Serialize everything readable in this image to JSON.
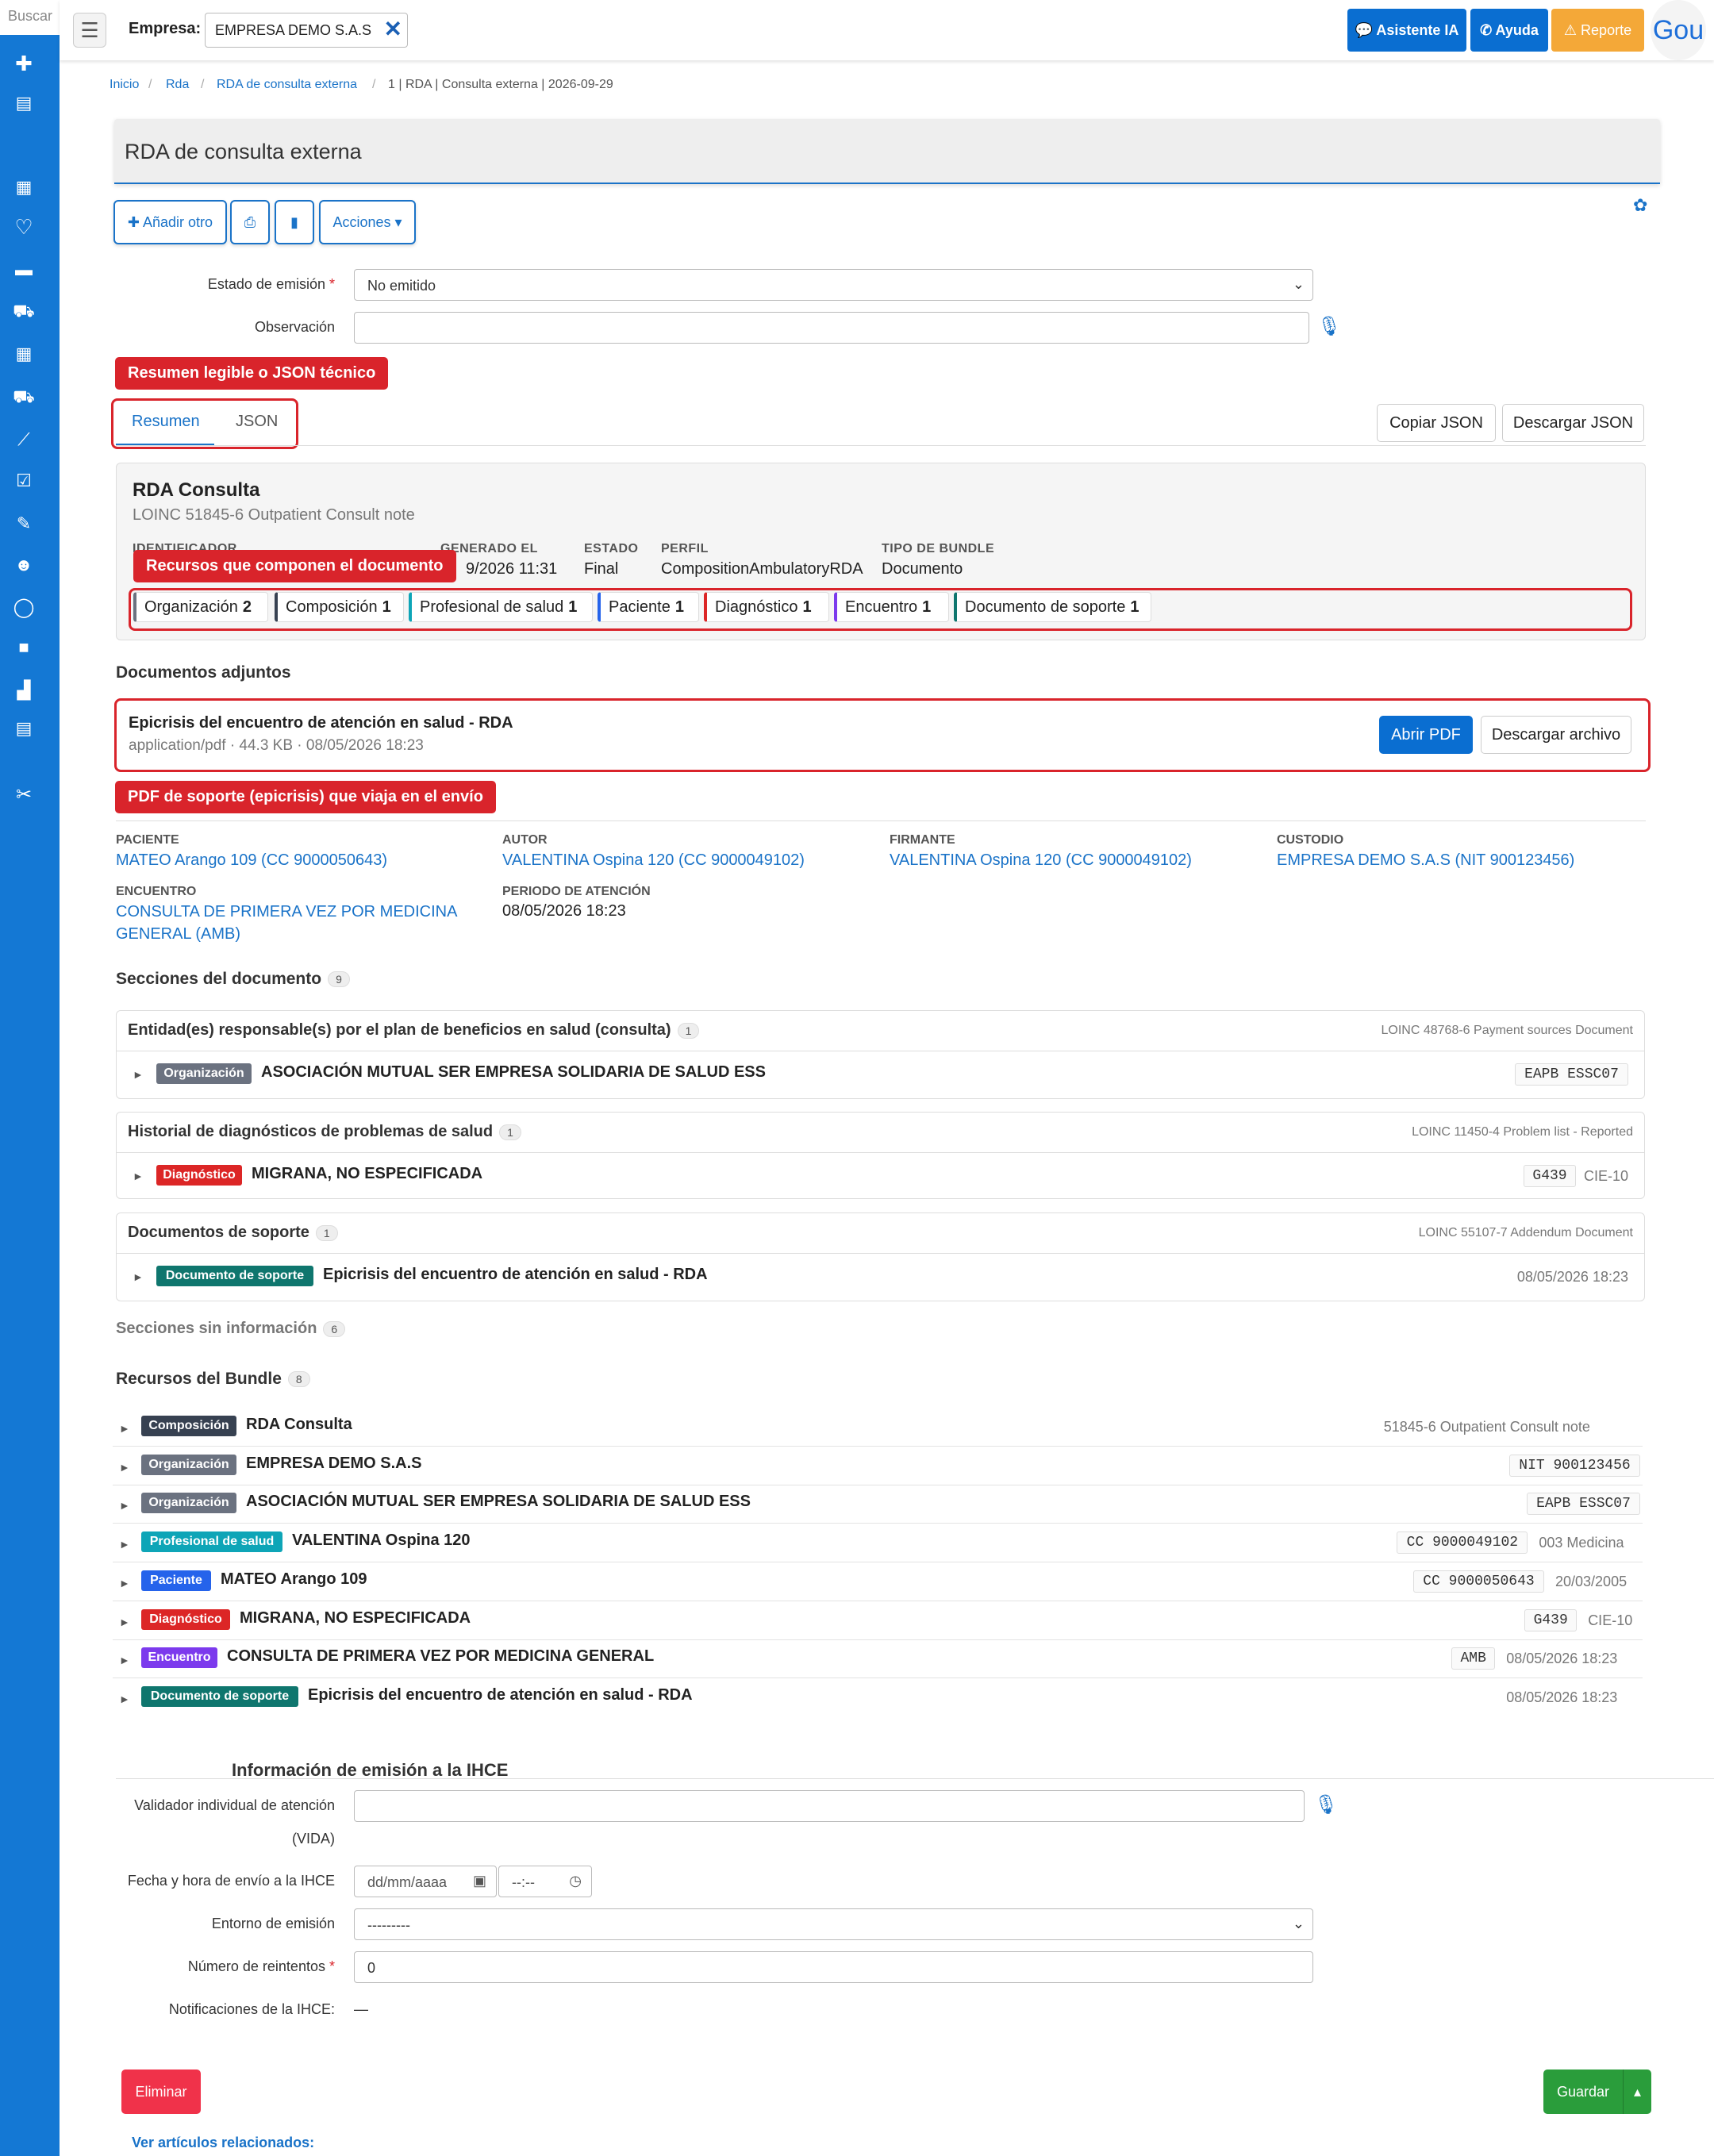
{
  "sidebar": {
    "search_label": "Buscar"
  },
  "topbar": {
    "empresa_label": "Empresa:",
    "empresa_value": "EMPRESA DEMO S.A.S",
    "asistente": "Asistente IA",
    "ayuda": "Ayuda",
    "reporte": "Reporte",
    "user": "Gou"
  },
  "breadcrumb": {
    "items": [
      "Inicio",
      "Rda",
      "RDA de consulta externa"
    ],
    "current": "1 | RDA | Consulta externa | 2026-09-29"
  },
  "page_title": "RDA de consulta externa",
  "actions": {
    "add": "Añadir otro",
    "acciones": "Acciones"
  },
  "form": {
    "estado_label": "Estado de emisión",
    "estado_value": "No emitido",
    "observacion_label": "Observación"
  },
  "annotations": {
    "a1": "Resumen legible o JSON técnico",
    "a2": "Recursos que componen el documento",
    "a3": "PDF de soporte (epicrisis) que viaja en el envío"
  },
  "tabs": {
    "resumen": "Resumen",
    "json": "JSON",
    "copy": "Copiar JSON",
    "download": "Descargar JSON"
  },
  "summary": {
    "title": "RDA Consulta",
    "subtitle": "LOINC 51845-6 Outpatient Consult note",
    "fields": [
      {
        "label": "IDENTIFICADOR",
        "value": ""
      },
      {
        "label": "GENERADO EL",
        "value": "9/2026 11:31"
      },
      {
        "label": "ESTADO",
        "value": "Final"
      },
      {
        "label": "PERFIL",
        "value": "CompositionAmbulatoryRDA"
      },
      {
        "label": "TIPO DE BUNDLE",
        "value": "Documento"
      }
    ],
    "chips": [
      {
        "label": "Organización",
        "count": "2",
        "color": "#6b7280"
      },
      {
        "label": "Composición",
        "count": "1",
        "color": "#374151"
      },
      {
        "label": "Profesional de salud",
        "count": "1",
        "color": "#0ea5b7"
      },
      {
        "label": "Paciente",
        "count": "1",
        "color": "#2563eb"
      },
      {
        "label": "Diagnóstico",
        "count": "1",
        "color": "#dc2626"
      },
      {
        "label": "Encuentro",
        "count": "1",
        "color": "#7c3aed"
      },
      {
        "label": "Documento de soporte",
        "count": "1",
        "color": "#0f766e"
      }
    ]
  },
  "attachments": {
    "heading": "Documentos adjuntos",
    "title": "Epicrisis del encuentro de atención en salud - RDA",
    "meta": "application/pdf · 44.3 KB · 08/05/2026 18:23",
    "open": "Abrir PDF",
    "download": "Descargar archivo"
  },
  "meta": [
    {
      "label": "PACIENTE",
      "value": "MATEO Arango 109 (CC 9000050643)"
    },
    {
      "label": "AUTOR",
      "value": "VALENTINA Ospina 120 (CC 9000049102)"
    },
    {
      "label": "FIRMANTE",
      "value": "VALENTINA Ospina 120 (CC 9000049102)"
    },
    {
      "label": "CUSTODIO",
      "value": "EMPRESA DEMO S.A.S (NIT 900123456)"
    },
    {
      "label": "ENCUENTRO",
      "value": "CONSULTA DE PRIMERA VEZ POR MEDICINA GENERAL (AMB)"
    },
    {
      "label": "PERIODO DE ATENCIÓN",
      "value": "08/05/2026 18:23"
    }
  ],
  "sections": {
    "heading": "Secciones del documento",
    "count": "9",
    "items": [
      {
        "title": "Entidad(es) responsable(s) por el plan de beneficios en salud (consulta)",
        "count": "1",
        "loinc": "LOINC 48768-6 Payment sources Document",
        "tag": "Organización",
        "tag_color": "#6b7280",
        "text": "ASOCIACIÓN MUTUAL SER EMPRESA SOLIDARIA DE SALUD ESS",
        "code": "EAPB ESSC07",
        "extra": ""
      },
      {
        "title": "Historial de diagnósticos de problemas de salud",
        "count": "1",
        "loinc": "LOINC 11450-4 Problem list - Reported",
        "tag": "Diagnóstico",
        "tag_color": "#dc2626",
        "text": "MIGRANA, NO ESPECIFICADA",
        "code": "G439",
        "extra": "CIE-10"
      },
      {
        "title": "Documentos de soporte",
        "count": "1",
        "loinc": "LOINC 55107-7 Addendum Document",
        "tag": "Documento de soporte",
        "tag_color": "#0f766e",
        "text": "Epicrisis del encuentro de atención en salud - RDA",
        "code": "",
        "extra": "08/05/2026 18:23"
      }
    ],
    "empty_label": "Secciones sin información",
    "empty_count": "6"
  },
  "bundle": {
    "heading": "Recursos del Bundle",
    "count": "8",
    "rows": [
      {
        "tag": "Composición",
        "color": "#374151",
        "text": "RDA Consulta",
        "code": "",
        "extra": "51845-6 Outpatient Consult note"
      },
      {
        "tag": "Organización",
        "color": "#6b7280",
        "text": "EMPRESA DEMO S.A.S",
        "code": "NIT 900123456",
        "extra": ""
      },
      {
        "tag": "Organización",
        "color": "#6b7280",
        "text": "ASOCIACIÓN MUTUAL SER EMPRESA SOLIDARIA DE SALUD ESS",
        "code": "EAPB ESSC07",
        "extra": ""
      },
      {
        "tag": "Profesional de salud",
        "color": "#0ea5b7",
        "text": "VALENTINA Ospina 120",
        "code": "CC 9000049102",
        "extra": "003 Medicina"
      },
      {
        "tag": "Paciente",
        "color": "#2563eb",
        "text": "MATEO Arango 109",
        "code": "CC 9000050643",
        "extra": "20/03/2005"
      },
      {
        "tag": "Diagnóstico",
        "color": "#dc2626",
        "text": "MIGRANA, NO ESPECIFICADA",
        "code": "G439",
        "extra": "CIE-10"
      },
      {
        "tag": "Encuentro",
        "color": "#7c3aed",
        "text": "CONSULTA DE PRIMERA VEZ POR MEDICINA GENERAL",
        "code": "AMB",
        "extra": "08/05/2026 18:23"
      },
      {
        "tag": "Documento de soporte",
        "color": "#0f766e",
        "text": "Epicrisis del encuentro de atención en salud - RDA",
        "code": "",
        "extra": "08/05/2026 18:23"
      }
    ]
  },
  "emission": {
    "heading": "Información de emisión a la IHCE",
    "validador_label": "Validador individual de atención",
    "validador_label2": "(VIDA)",
    "fecha_label": "Fecha y hora de envío a la IHCE",
    "date_ph": "dd/mm/aaaa",
    "time_ph": "--:--",
    "entorno_label": "Entorno de emisión",
    "entorno_value": "---------",
    "reintentos_label": "Número de reintentos",
    "reintentos_value": "0",
    "notif_label": "Notificaciones de la IHCE:",
    "notif_value": "—"
  },
  "footer": {
    "eliminar": "Eliminar",
    "guardar": "Guardar",
    "related": "Ver artículos relacionados:"
  }
}
